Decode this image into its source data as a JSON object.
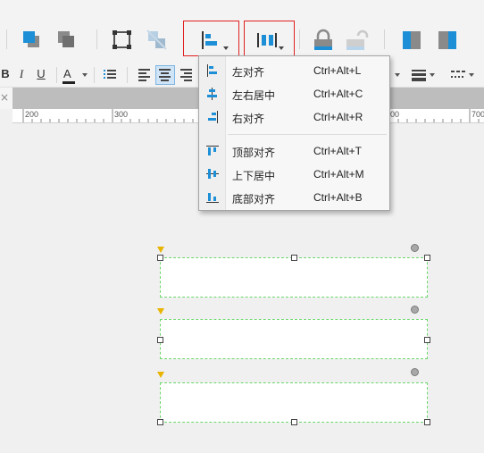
{
  "toolbar": {
    "buttons": [
      {
        "name": "bring-forward-icon"
      },
      {
        "name": "send-backward-icon"
      },
      {
        "name": "group-icon"
      },
      {
        "name": "ungroup-icon"
      },
      {
        "name": "align-left-icon"
      },
      {
        "name": "distribute-icon"
      },
      {
        "name": "lock-icon"
      },
      {
        "name": "unlock-icon"
      },
      {
        "name": "left-panel-icon"
      },
      {
        "name": "right-panel-icon"
      }
    ],
    "colors": {
      "blue": "#1c8fd6",
      "gray": "#8a8a8a",
      "highlight": "#e02020"
    }
  },
  "format_bar": {
    "bold": "B",
    "italic": "I",
    "underline": "U",
    "font_color": "A"
  },
  "ruler": {
    "labels": [
      "200",
      "300",
      "00",
      "700"
    ]
  },
  "tab": {
    "close": "×"
  },
  "align_menu": {
    "items": [
      {
        "label": "左对齐",
        "shortcut": "Ctrl+Alt+L",
        "icon": "align-left-icon"
      },
      {
        "label": "左右居中",
        "shortcut": "Ctrl+Alt+C",
        "icon": "align-center-icon"
      },
      {
        "label": "右对齐",
        "shortcut": "Ctrl+Alt+R",
        "icon": "align-right-icon"
      },
      {
        "label": "顶部对齐",
        "shortcut": "Ctrl+Alt+T",
        "icon": "align-top-icon"
      },
      {
        "label": "上下居中",
        "shortcut": "Ctrl+Alt+M",
        "icon": "align-middle-icon"
      },
      {
        "label": "底部对齐",
        "shortcut": "Ctrl+Alt+B",
        "icon": "align-bottom-icon"
      }
    ]
  },
  "canvas": {
    "widget_count": 3
  }
}
